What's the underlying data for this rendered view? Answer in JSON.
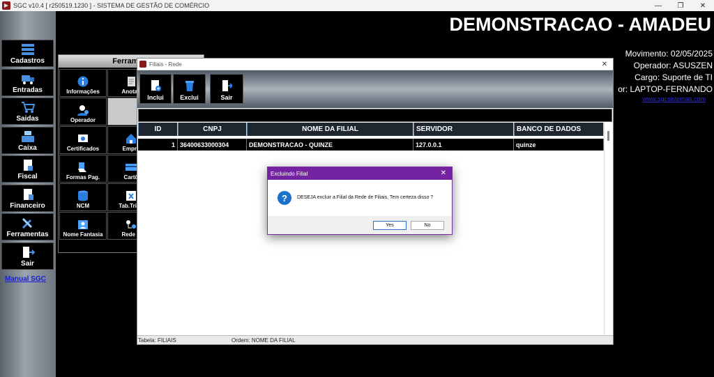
{
  "window": {
    "title": "SGC v10.4 [ r250519.1230 ] - SISTEMA DE GESTÃO DE COMÉRCIO",
    "minimize": "—",
    "maximize": "❐",
    "close": "✕"
  },
  "left_menu": {
    "items": [
      {
        "label": "Cadastros",
        "icon": "stack-icon"
      },
      {
        "label": "Entradas",
        "icon": "truck-icon"
      },
      {
        "label": "Saidas",
        "icon": "cart-icon"
      },
      {
        "label": "Caixa",
        "icon": "register-icon"
      },
      {
        "label": "Fiscal",
        "icon": "document-icon"
      },
      {
        "label": "Financeiro",
        "icon": "ledger-icon"
      },
      {
        "label": "Ferramentas",
        "icon": "tools-icon"
      },
      {
        "label": "Sair",
        "icon": "exit-door-icon"
      }
    ],
    "manual_link": "Manual SGC"
  },
  "header": {
    "company": "DEMONSTRACAO - AMADEU",
    "movimento": "Movimento: 02/05/2025",
    "operador": "Operador: ASUSZEN",
    "cargo": "Cargo: Suporte de TI",
    "computador": "or: LAPTOP-FERNANDO",
    "site": "www.sgcsistemas.com"
  },
  "ferramentas": {
    "title": "Ferrame",
    "tiles": [
      {
        "label": "Informações",
        "icon": "info-icon"
      },
      {
        "label": "Anotaç",
        "icon": "notes-icon"
      },
      {
        "label": "Operador",
        "icon": "user-icon"
      },
      {
        "label": "",
        "icon": ""
      },
      {
        "label": "Certificados",
        "icon": "certificate-icon"
      },
      {
        "label": "Empre",
        "icon": "house-icon"
      },
      {
        "label": "Formas Pag.",
        "icon": "card-hand-icon"
      },
      {
        "label": "Cartõ",
        "icon": "credit-card-icon"
      },
      {
        "label": "NCM",
        "icon": "database-icon"
      },
      {
        "label": "Tab.Tribu",
        "icon": "spreadsheet-icon"
      },
      {
        "label": "Nome Fantasia",
        "icon": "id-badge-icon"
      },
      {
        "label": "Rede S",
        "icon": "network-icon"
      }
    ]
  },
  "filiais": {
    "title": "Filiais - Rede",
    "close": "✕",
    "toolbar": [
      {
        "label": "Inclui",
        "icon": "add-document-icon"
      },
      {
        "label": "Exclui",
        "icon": "trash-icon"
      },
      {
        "label": "Sair",
        "icon": "exit-door-icon"
      }
    ],
    "columns": [
      "ID",
      "CNPJ",
      "NOME DA FILIAL",
      "SERVIDOR",
      "BANCO DE DADOS"
    ],
    "rows": [
      {
        "id": "1",
        "cnpj": "36400633000304",
        "nome": "DEMONSTRACAO - QUINZE",
        "servidor": "127.0.0.1",
        "banco": "quinze"
      }
    ],
    "status_tabela": "Tabela: FILIAIS",
    "status_ordem": "Ordem: NOME DA FILIAL"
  },
  "dialog": {
    "title": "Excluindo Filial",
    "close": "✕",
    "message": "DESEJA excluir a Filial da Rede de Filiais, Tem certeza disso ?",
    "icon": "question-icon",
    "yes": "Yes",
    "no": "No"
  },
  "colors": {
    "dialog_title": "#7424a0",
    "question_icon": "#1a73c9",
    "link": "#1b1bd6"
  }
}
